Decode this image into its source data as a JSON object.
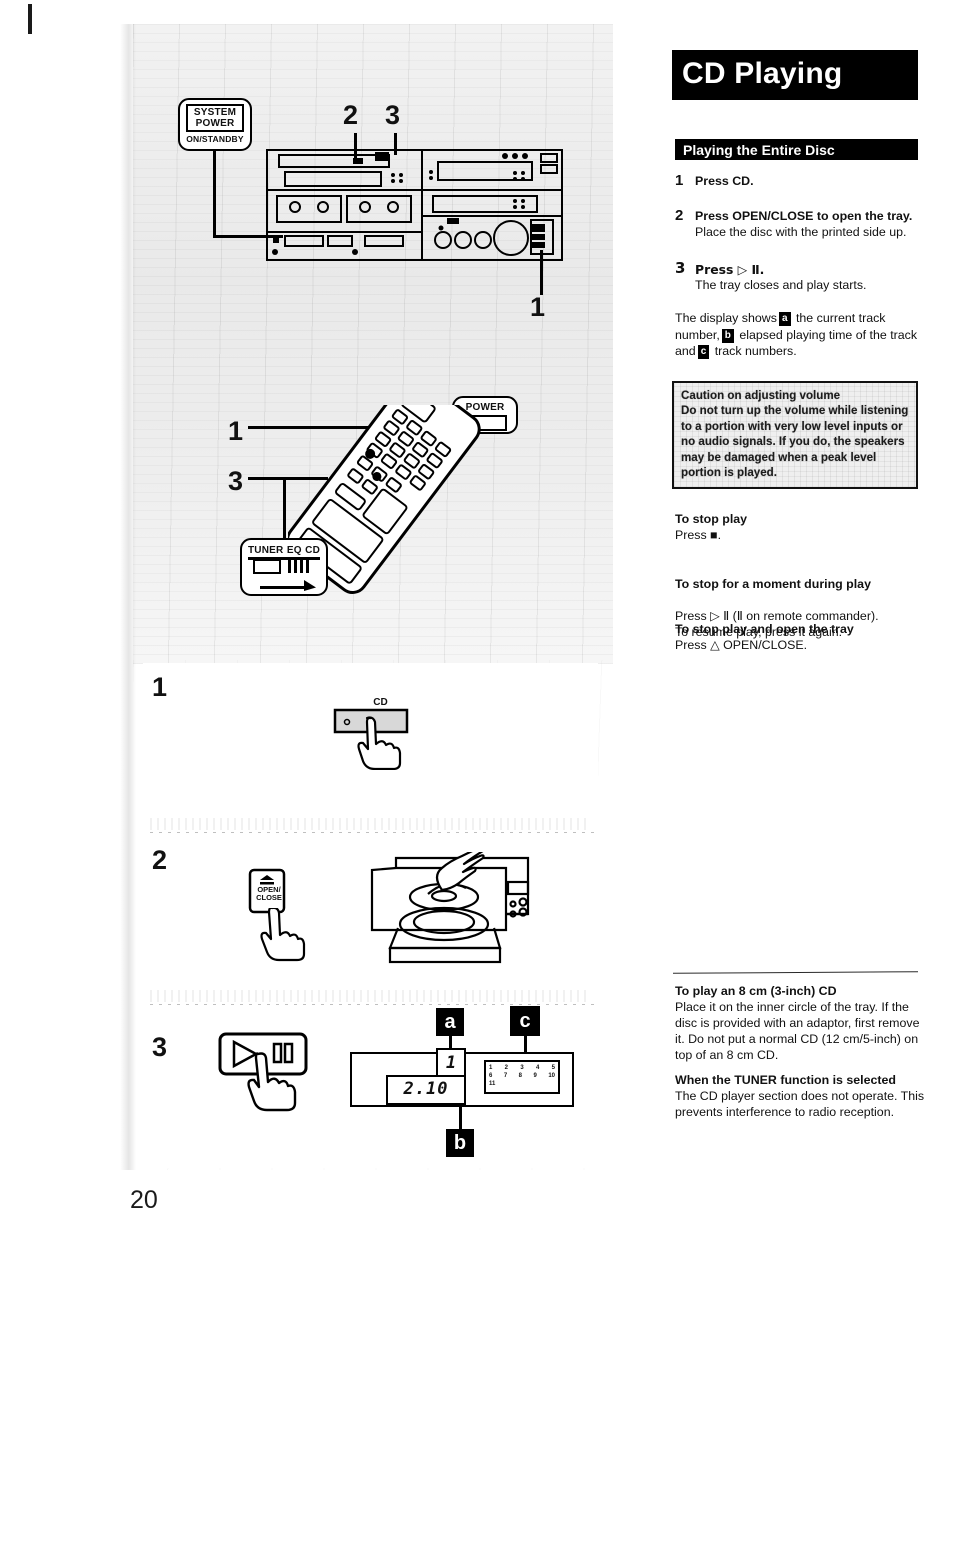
{
  "page": {
    "number": "20"
  },
  "header": {
    "title": "CD Playing",
    "section": "Playing the Entire Disc"
  },
  "steps": [
    {
      "num": "1",
      "bold": "Press CD.",
      "detail": ""
    },
    {
      "num": "2",
      "bold": "Press OPEN/CLOSE to open the tray.",
      "detail": "Place the disc with the printed side up."
    },
    {
      "num": "3",
      "bold": "Press ▷ Ⅱ.",
      "detail": "The tray closes and play starts."
    }
  ],
  "display_para": {
    "t1": "The display shows",
    "m1": "a",
    "t2": "the current track number,",
    "m2": "b",
    "t3": "elapsed playing time of the track and",
    "m3": "c",
    "t4": "track numbers."
  },
  "caution": {
    "heading": "Caution on adjusting volume",
    "body": "Do not turn up the volume while listening to a portion with very low level inputs or no audio signals.  If you do, the speakers may be damaged when a peak level portion is played."
  },
  "sections": [
    {
      "heading": "To stop play",
      "body": "Press ■."
    },
    {
      "heading": "To stop for a moment during play",
      "body": "Press ▷ Ⅱ (Ⅱ on remote commander).\nTo resume play, press it again."
    },
    {
      "heading": "To stop play and open the tray",
      "body": "Press △ OPEN/CLOSE."
    }
  ],
  "notes": [
    {
      "heading": "To play an 8 cm (3-inch) CD",
      "body": "Place it on the inner circle of the tray.  If the disc is provided with an adaptor, first remove it.  Do not put a normal CD (12 cm/5-inch) on top of an 8 cm CD."
    },
    {
      "heading": "When the TUNER function is selected",
      "body": "The CD player section does not operate. This prevents interference to radio reception."
    }
  ],
  "illustration": {
    "callout_system_power": {
      "line1": "SYSTEM",
      "line2": "POWER",
      "line3": "ON/STANDBY"
    },
    "callout_power": {
      "label": "POWER"
    },
    "callout_function": {
      "l1": "TUNER",
      "l2": "EQ",
      "l3": "CD"
    },
    "markers": {
      "top2": "2",
      "top3": "3",
      "right1": "1",
      "remote1": "1",
      "remote3": "3"
    }
  },
  "procedure_figs": {
    "step1": {
      "num": "1",
      "button_label": "CD"
    },
    "step2": {
      "num": "2",
      "button_l1": "OPEN/",
      "button_l2": "CLOSE"
    },
    "step3": {
      "num": "3",
      "marker_a": "a",
      "marker_b": "b",
      "marker_c": "c",
      "track_display": "1",
      "time_display": "2.10",
      "track_grid_row1": [
        "1",
        "2",
        "3",
        "4",
        "5"
      ],
      "track_grid_row2": [
        "6",
        "7",
        "8",
        "9",
        "10"
      ],
      "track_grid_row3": [
        "11"
      ]
    }
  },
  "colors": {
    "ink": "#000000",
    "paper": "#ffffff",
    "scan_grey": "#ededed"
  }
}
